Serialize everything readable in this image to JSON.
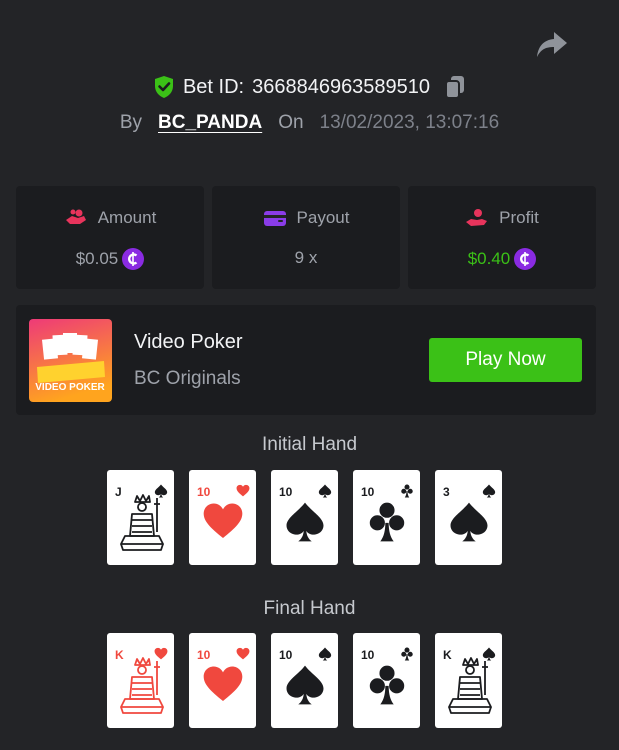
{
  "header": {
    "bet_id_label": "Bet ID:",
    "bet_id_value": "3668846963589510",
    "by_label": "By",
    "username": "BC_PANDA",
    "on_label": "On",
    "datetime": "13/02/2023, 13:07:16"
  },
  "stats": {
    "amount": {
      "label": "Amount",
      "value": "$0.05"
    },
    "payout": {
      "label": "Payout",
      "value": "9 x"
    },
    "profit": {
      "label": "Profit",
      "value": "$0.40"
    }
  },
  "game": {
    "title": "Video Poker",
    "provider": "BC Originals",
    "thumb_text": "VIDEO POKER",
    "play_label": "Play Now"
  },
  "initial_hand": {
    "title": "Initial Hand",
    "cards": [
      {
        "rank": "J",
        "suit": "spade",
        "face": true
      },
      {
        "rank": "10",
        "suit": "heart",
        "face": false
      },
      {
        "rank": "10",
        "suit": "spade",
        "face": false
      },
      {
        "rank": "10",
        "suit": "club",
        "face": false
      },
      {
        "rank": "3",
        "suit": "spade",
        "face": false
      }
    ]
  },
  "final_hand": {
    "title": "Final Hand",
    "cards": [
      {
        "rank": "K",
        "suit": "heart",
        "face": true
      },
      {
        "rank": "10",
        "suit": "heart",
        "face": false
      },
      {
        "rank": "10",
        "suit": "spade",
        "face": false
      },
      {
        "rank": "10",
        "suit": "club",
        "face": false
      },
      {
        "rank": "K",
        "suit": "spade",
        "face": true
      }
    ]
  },
  "colors": {
    "background": "#232427",
    "panel": "#1b1c1f",
    "accent_green": "#3bc117",
    "coin_purple": "#8a2be2",
    "red_suit": "#f0483e",
    "black_suit": "#1b1c1f"
  },
  "icons": {
    "share": "share-icon",
    "shield": "shield-check-icon",
    "copy": "copy-icon",
    "amount": "coins-icon",
    "payout": "wallet-icon",
    "profit": "hand-coin-icon",
    "coin": "bc-coin-icon"
  }
}
